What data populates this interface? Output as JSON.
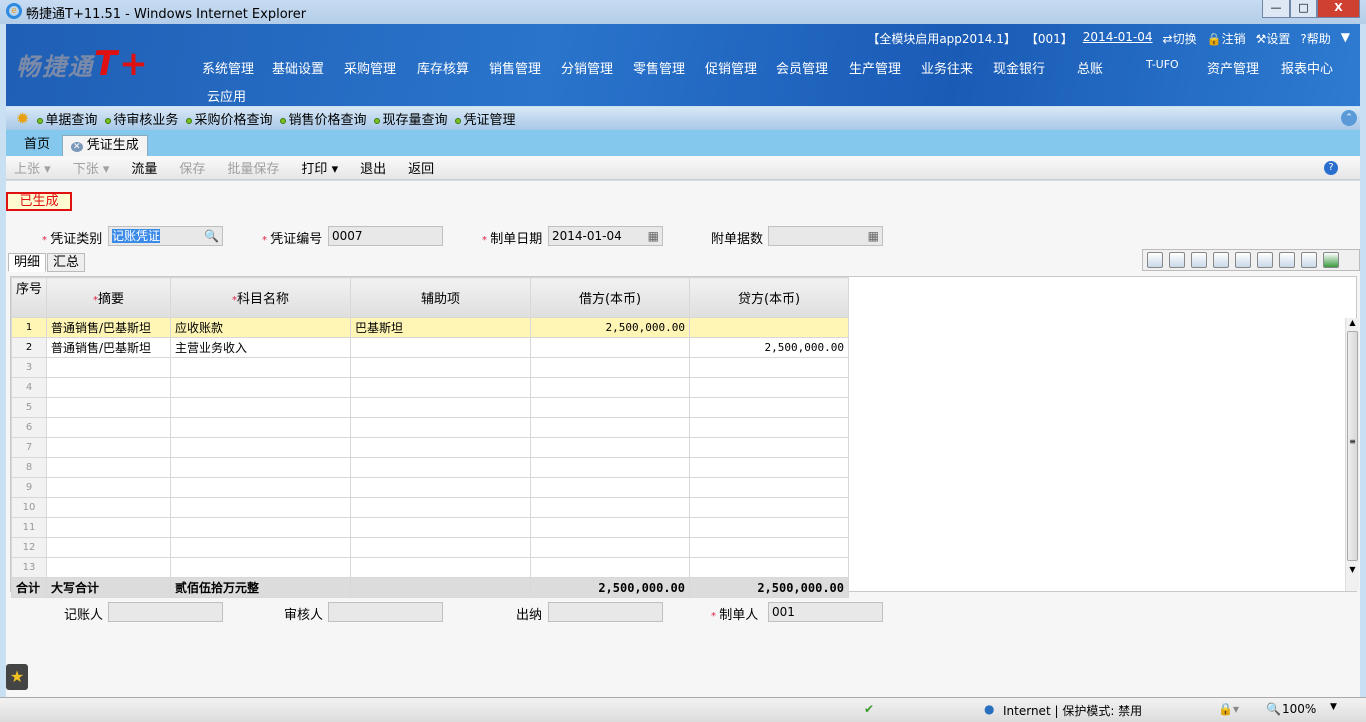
{
  "window": {
    "title": "畅捷通T+11.51 - Windows Internet Explorer",
    "min": "—",
    "max": "□",
    "close": "X"
  },
  "header": {
    "logo_text": "畅捷通",
    "logo_brand": "T+",
    "menu": [
      "系统管理",
      "基础设置",
      "采购管理",
      "库存核算",
      "销售管理",
      "分销管理",
      "零售管理",
      "促销管理",
      "会员管理",
      "生产管理",
      "业务往来",
      "现金银行",
      "总账",
      "T-UFO",
      "资产管理",
      "报表中心"
    ],
    "menu2": "云应用",
    "account": "【全模块启用app2014.1】",
    "user": "【001】",
    "date": "2014-01-04",
    "switch": "切换",
    "logout": "注销",
    "settings": "设置",
    "help": "帮助"
  },
  "nav": [
    "单据查询",
    "待审核业务",
    "采购价格查询",
    "销售价格查询",
    "现存量查询",
    "凭证管理"
  ],
  "page_tabs": {
    "home": "首页",
    "active": "凭证生成"
  },
  "toolbar": {
    "prev": "上张",
    "next": "下张",
    "flow": "流量",
    "save": "保存",
    "batch_save": "批量保存",
    "print": "打印",
    "exit": "退出",
    "back": "返回"
  },
  "status_badge": "已生成",
  "form": {
    "type_label": "凭证类别",
    "type_value": "记账凭证",
    "no_label": "凭证编号",
    "no_value": "0007",
    "date_label": "制单日期",
    "date_value": "2014-01-04",
    "attach_label": "附单据数",
    "attach_value": ""
  },
  "sub_tabs": [
    "明细",
    "汇总"
  ],
  "grid": {
    "headers": [
      "序号",
      "摘要",
      "科目名称",
      "辅助项",
      "借方(本币)",
      "贷方(本币)"
    ],
    "rows": [
      {
        "n": "1",
        "summary": "普通销售/巴基斯坦",
        "account": "应收账款",
        "aux": "巴基斯坦",
        "debit": "2,500,000.00",
        "credit": ""
      },
      {
        "n": "2",
        "summary": "普通销售/巴基斯坦",
        "account": "主营业务收入",
        "aux": "",
        "debit": "",
        "credit": "2,500,000.00"
      },
      {
        "n": "3"
      },
      {
        "n": "4"
      },
      {
        "n": "5"
      },
      {
        "n": "6"
      },
      {
        "n": "7"
      },
      {
        "n": "8"
      },
      {
        "n": "9"
      },
      {
        "n": "10"
      },
      {
        "n": "11"
      },
      {
        "n": "12"
      },
      {
        "n": "13"
      }
    ],
    "total": {
      "label": "合计",
      "summary": "大写合计",
      "words": "贰佰伍拾万元整",
      "debit": "2,500,000.00",
      "credit": "2,500,000.00"
    }
  },
  "footer": {
    "bookkeeper_label": "记账人",
    "bookkeeper": "",
    "auditor_label": "审核人",
    "auditor": "",
    "cashier_label": "出纳",
    "cashier": "",
    "maker_label": "制单人",
    "maker": "001"
  },
  "statusbar": {
    "zone": "Internet | 保护模式: 禁用",
    "zoom": "100%"
  }
}
